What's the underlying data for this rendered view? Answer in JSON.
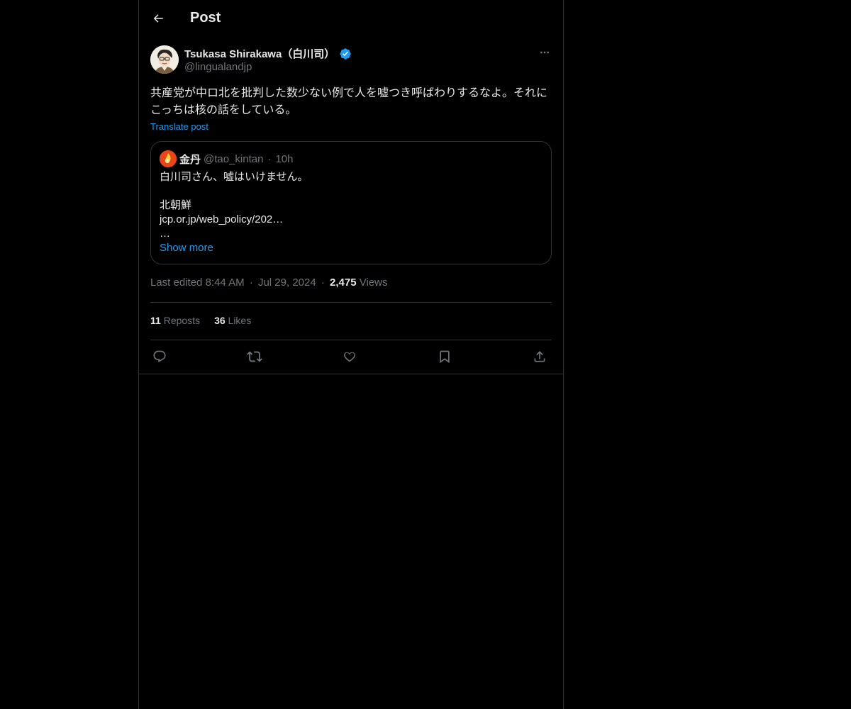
{
  "header": {
    "title": "Post",
    "back_icon": "arrow-left-icon"
  },
  "post": {
    "author": {
      "name": "Tsukasa Shirakawa（白川司）",
      "handle": "@lingualandjp",
      "verified": true,
      "verified_color": "#1d9bf0"
    },
    "text": "共産党が中ロ北を批判した数少ない例で人を嘘つき呼ばわりするなよ。それにこっちは核の話をしている。",
    "translate_label": "Translate post",
    "quote": {
      "name": "金丹",
      "handle": "@tao_kintan",
      "separator": "·",
      "time": "10h",
      "lines": [
        "白川司さん、嘘はいけません。",
        "",
        "北朝鮮",
        "jcp.or.jp/web_policy/202…",
        "…"
      ],
      "show_more": "Show more"
    },
    "meta": {
      "edited_prefix": "Last edited",
      "time": "8:44 AM",
      "separator": "·",
      "date": "Jul 29, 2024",
      "views_count": "2,475",
      "views_label": "Views"
    },
    "stats": {
      "reposts_count": "11",
      "reposts_label": "Reposts",
      "likes_count": "36",
      "likes_label": "Likes"
    },
    "actions": [
      {
        "name": "reply",
        "icon": "reply-icon"
      },
      {
        "name": "repost",
        "icon": "repost-icon"
      },
      {
        "name": "like",
        "icon": "heart-icon"
      },
      {
        "name": "bookmark",
        "icon": "bookmark-icon"
      },
      {
        "name": "share",
        "icon": "share-icon"
      }
    ]
  },
  "colors": {
    "background": "#000000",
    "text": "#e7e9ea",
    "secondary": "#71767b",
    "link": "#1d9bf0",
    "border": "#2f3336"
  }
}
